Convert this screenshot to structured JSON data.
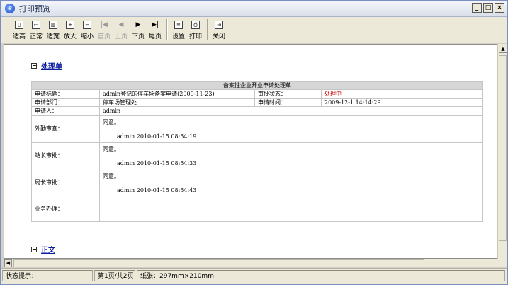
{
  "window": {
    "title": "打印预览"
  },
  "toolbar": {
    "fit": "适高",
    "normal": "正常",
    "fit_width": "适宽",
    "zoom_in": "放大",
    "zoom_out": "缩小",
    "first_page": "首页",
    "prev_page": "上页",
    "next_page": "下页",
    "last_page": "尾页",
    "settings": "设置",
    "print": "打印",
    "close": "关闭"
  },
  "sections": {
    "handling": "处理单",
    "body": "正文"
  },
  "form": {
    "caption": "备案性企业开业申请处理单",
    "rows": {
      "title_label": "申请标题：",
      "title_value": "admin登记的停车场备案申请(2009-11-23)",
      "status_label": "审批状态：",
      "status_value": "处理中",
      "dept_label": "申请部门：",
      "dept_value": "停车场管理处",
      "time_label": "申请时间：",
      "time_value": "2009-12-1 14:14:29",
      "applicant_label": "申请人：",
      "applicant_value": "admin"
    },
    "approvals": [
      {
        "label": "外勤审查：",
        "opinion": "同意。",
        "signature": "admin 2010-01-15 08:54:19"
      },
      {
        "label": "站长审批：",
        "opinion": "同意。",
        "signature": "admin 2010-01-15 08:54:33"
      },
      {
        "label": "局长审批：",
        "opinion": "同意。",
        "signature": "admin 2010-01-15 08:54:43"
      }
    ],
    "business_label": "业务办理："
  },
  "status": {
    "prompt": "状态提示：",
    "page": "第1页/共2页",
    "paper": "纸张：297mm×210mm"
  },
  "colors": {
    "status_processing": "#cc0000",
    "link": "#0a1ea0"
  }
}
